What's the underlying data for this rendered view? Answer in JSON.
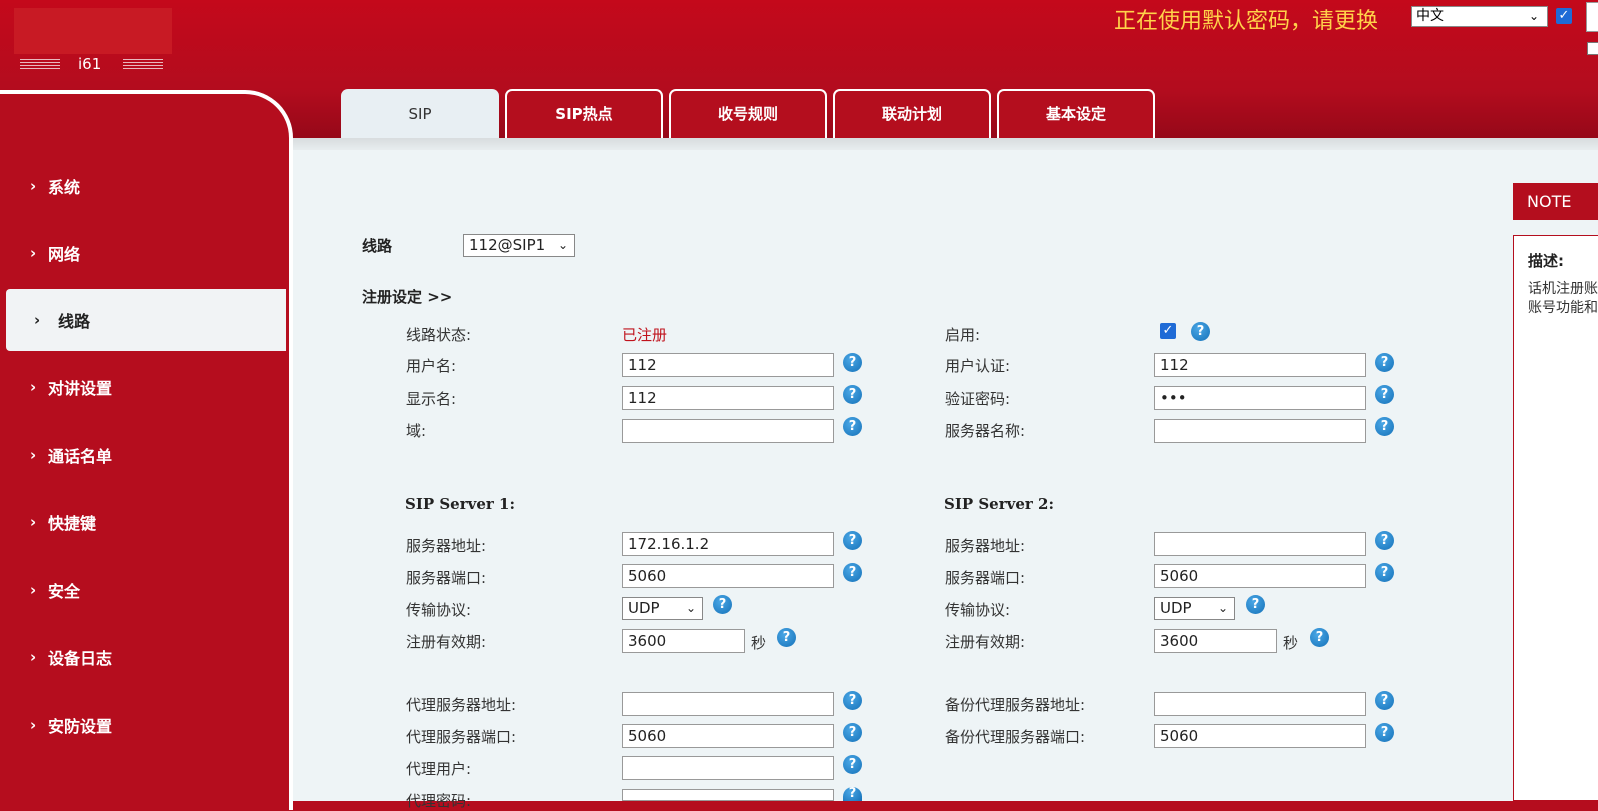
{
  "header": {
    "model": "i61",
    "warning": "正在使用默认密码，请更换",
    "language": "中文",
    "checkbox_checked": true
  },
  "tabs": [
    {
      "label": "SIP",
      "active": true
    },
    {
      "label": "SIP热点",
      "active": false
    },
    {
      "label": "收号规则",
      "active": false
    },
    {
      "label": "联动计划",
      "active": false
    },
    {
      "label": "基本设定",
      "active": false
    }
  ],
  "sidebar": {
    "items": [
      {
        "label": "系统",
        "active": false
      },
      {
        "label": "网络",
        "active": false
      },
      {
        "label": "线路",
        "active": true
      },
      {
        "label": "对讲设置",
        "active": false
      },
      {
        "label": "通话名单",
        "active": false
      },
      {
        "label": "快捷键",
        "active": false
      },
      {
        "label": "安全",
        "active": false
      },
      {
        "label": "设备日志",
        "active": false
      },
      {
        "label": "安防设置",
        "active": false
      }
    ]
  },
  "line": {
    "label": "线路",
    "selected": "112@SIP1"
  },
  "registration": {
    "section_title": "注册设定 >>",
    "line_status_label": "线路状态:",
    "line_status_value": "已注册",
    "enable_label": "启用:",
    "enable_checked": true,
    "username_label": "用户名:",
    "username_value": "112",
    "auth_user_label": "用户认证:",
    "auth_user_value": "112",
    "display_name_label": "显示名:",
    "display_name_value": "112",
    "auth_password_label": "验证密码:",
    "auth_password_value": "•••",
    "domain_label": "域:",
    "domain_value": "",
    "server_name_label": "服务器名称:",
    "server_name_value": ""
  },
  "sip_server_1": {
    "title": "SIP Server 1:",
    "address_label": "服务器地址:",
    "address_value": "172.16.1.2",
    "port_label": "服务器端口:",
    "port_value": "5060",
    "transport_label": "传输协议:",
    "transport_value": "UDP",
    "expiry_label": "注册有效期:",
    "expiry_value": "3600",
    "expiry_unit": "秒"
  },
  "sip_server_2": {
    "title": "SIP Server 2:",
    "address_label": "服务器地址:",
    "address_value": "",
    "port_label": "服务器端口:",
    "port_value": "5060",
    "transport_label": "传输协议:",
    "transport_value": "UDP",
    "expiry_label": "注册有效期:",
    "expiry_value": "3600",
    "expiry_unit": "秒"
  },
  "proxy": {
    "proxy_address_label": "代理服务器地址:",
    "proxy_address_value": "",
    "proxy_port_label": "代理服务器端口:",
    "proxy_port_value": "5060",
    "proxy_user_label": "代理用户:",
    "proxy_user_value": "",
    "proxy_password_label": "代理密码:",
    "backup_address_label": "备份代理服务器地址:",
    "backup_address_value": "",
    "backup_port_label": "备份代理服务器端口:",
    "backup_port_value": "5060"
  },
  "note": {
    "header": "NOTE",
    "title": "描述:",
    "line1": "话机注册账",
    "line2": "账号功能和"
  },
  "icons": {
    "help": "?",
    "check": "✓",
    "chevron": "›",
    "dropdown": "⌄"
  }
}
